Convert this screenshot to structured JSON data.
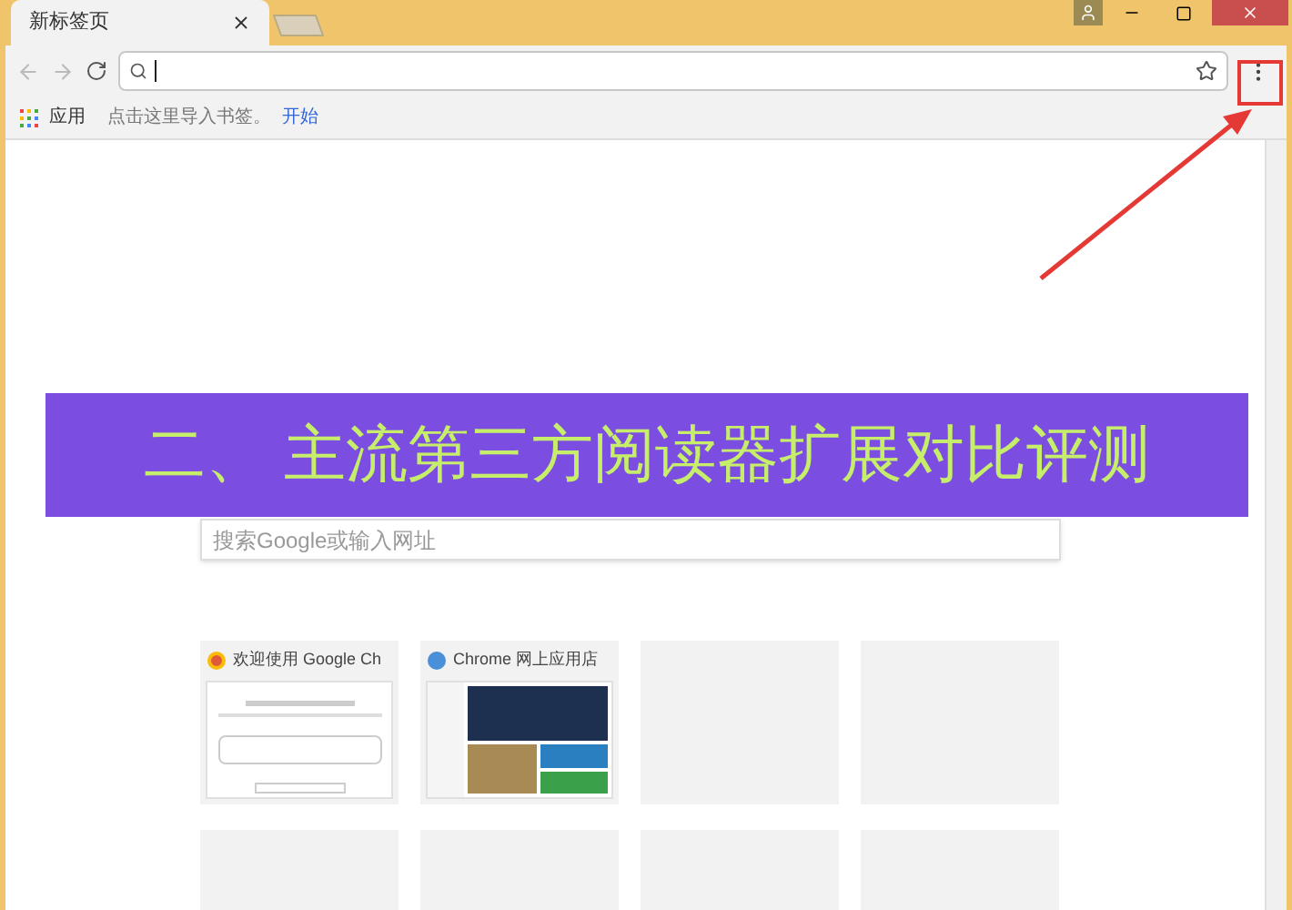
{
  "tabs": [
    {
      "label": "新标签页",
      "selected": true
    }
  ],
  "bookmarks_bar": {
    "apps": "应用",
    "hint": "点击这里导入书签。",
    "link": "开始"
  },
  "search": {
    "placeholder": "搜索Google或输入网址"
  },
  "tiles": [
    {
      "kind": "page",
      "title": "欢迎使用 Google Ch"
    },
    {
      "kind": "store",
      "title": "Chrome 网上应用店"
    },
    {
      "kind": "empty"
    },
    {
      "kind": "empty"
    },
    {
      "kind": "empty"
    },
    {
      "kind": "empty"
    },
    {
      "kind": "empty"
    },
    {
      "kind": "empty"
    }
  ],
  "banner": {
    "text": "二、 主流第三方阅读器扩展对比评测"
  }
}
